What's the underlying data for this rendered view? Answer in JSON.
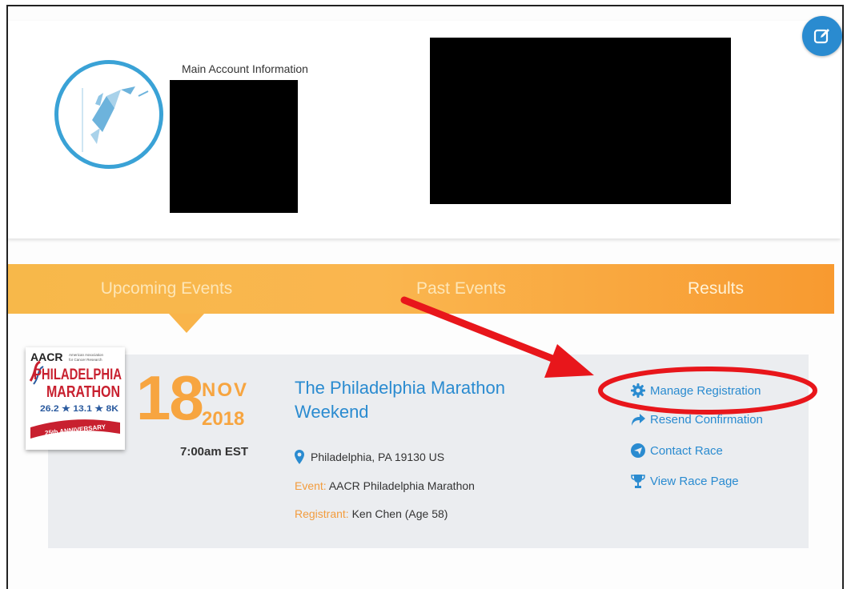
{
  "account": {
    "title": "Main Account Information",
    "edit_icon": "edit-icon"
  },
  "tabs": [
    {
      "label": "Upcoming Events",
      "active": true
    },
    {
      "label": "Past Events",
      "active": false
    },
    {
      "label": "Results",
      "active": false
    }
  ],
  "event": {
    "logo": {
      "line1": "AACR",
      "line1_small": "American Association for Cancer Research",
      "line2": "PHILADELPHIA",
      "line3": "MARATHON",
      "distances": "26.2 ★ 13.1 ★ 8K",
      "ribbon": "25th ANNIVERSARY"
    },
    "day": "18",
    "month": "NOV",
    "year": "2018",
    "time": "7:00am EST",
    "title": "The Philadelphia Marathon Weekend",
    "location": "Philadelphia, PA 19130 US",
    "event_label": "Event:",
    "event_value": "AACR Philadelphia Marathon",
    "registrant_label": "Registrant:",
    "registrant_value": "Ken Chen (Age 58)",
    "actions": [
      {
        "label": "Manage Registration",
        "icon": "gear-icon"
      },
      {
        "label": "Resend Confirmation",
        "icon": "share-arrow-icon"
      },
      {
        "label": "Contact Race",
        "icon": "send-icon"
      },
      {
        "label": "View Race Page",
        "icon": "trophy-icon"
      }
    ]
  },
  "colors": {
    "accent_blue": "#2a8bd0",
    "orange": "#f7a540",
    "annotation_red": "#e8161b"
  }
}
